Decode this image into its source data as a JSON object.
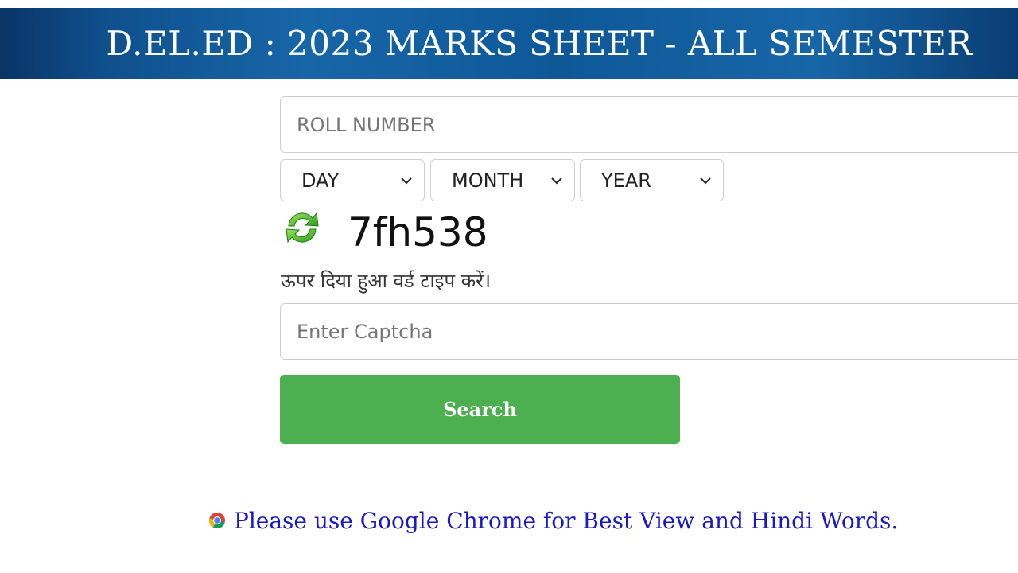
{
  "header": {
    "title": "D.EL.ED : 2023 MARKS SHEET - ALL SEMESTER"
  },
  "form": {
    "roll_placeholder": "ROLL NUMBER",
    "day_value": "DAY",
    "month_value": "MONTH",
    "year_value": "YEAR",
    "captcha_code": "7fh538",
    "captcha_hint": "ऊपर दिया हुआ वर्ड टाइप करें।",
    "captcha_placeholder": "Enter Captcha",
    "search_label": "Search"
  },
  "footer": {
    "note": "Please use Google Chrome for Best View and Hindi Words."
  },
  "icons": {
    "refresh": "refresh-icon",
    "chevron": "chevron-down-icon",
    "chrome": "chrome-icon"
  },
  "colors": {
    "header_bg": "#0f4f8c",
    "button_bg": "#4caf50",
    "footer_text": "#1a16c9"
  }
}
